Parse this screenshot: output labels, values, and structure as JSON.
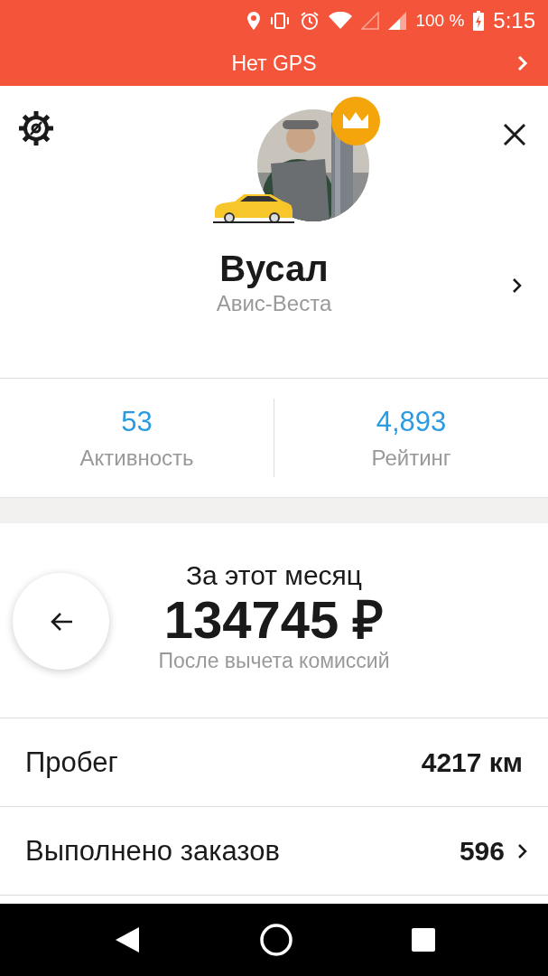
{
  "status_bar": {
    "battery": "100 %",
    "time": "5:15"
  },
  "banner": {
    "title": "Нет GPS"
  },
  "profile": {
    "name": "Вусал",
    "company": "Авис-Веста"
  },
  "stats": [
    {
      "value": "53",
      "label": "Активность"
    },
    {
      "value": "4,893",
      "label": "Рейтинг"
    }
  ],
  "earnings": {
    "period": "За этот месяц",
    "amount": "134745 ₽",
    "note": "После вычета комиссий"
  },
  "rows": [
    {
      "label": "Пробег",
      "value": "4217 км",
      "has_arrow": false
    },
    {
      "label": "Выполнено заказов",
      "value": "596",
      "has_arrow": true
    }
  ]
}
